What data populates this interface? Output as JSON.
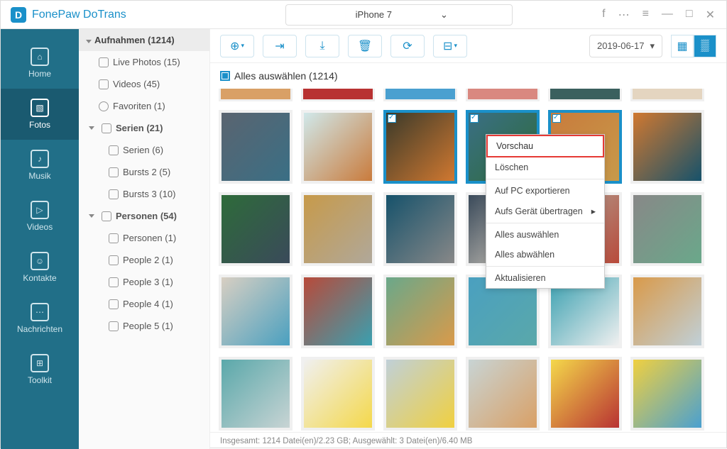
{
  "app_title": "FonePaw DoTrans",
  "device": "iPhone 7",
  "nav": {
    "home": "Home",
    "fotos": "Fotos",
    "musik": "Musik",
    "videos": "Videos",
    "kontakte": "Kontakte",
    "nachrichten": "Nachrichten",
    "toolkit": "Toolkit"
  },
  "tree": {
    "head": "Aufnahmen (1214)",
    "live": "Live Photos (15)",
    "videos": "Videos (45)",
    "fav": "Favoriten (1)",
    "serien_h": "Serien (21)",
    "serien": "Serien (6)",
    "b2": "Bursts 2 (5)",
    "b3": "Bursts 3 (10)",
    "pers_h": "Personen (54)",
    "pers": "Personen (1)",
    "p2": "People 2 (1)",
    "p3": "People 3 (1)",
    "p4": "People 4 (1)",
    "p5": "People 5 (1)"
  },
  "date": "2019-06-17",
  "selectall": "Alles auswählen (1214)",
  "ctx": {
    "vorschau": "Vorschau",
    "loeschen": "Löschen",
    "export_pc": "Auf PC exportieren",
    "aufs_geraet": "Aufs Gerät übertragen",
    "alles_aus": "Alles auswählen",
    "alles_ab": "Alles abwählen",
    "aktual": "Aktualisieren"
  },
  "status": "Insgesamt: 1214 Datei(en)/2.23 GB; Ausgewählt: 3 Datei(en)/6.40 MB",
  "thumb_colors": [
    "#d9a066",
    "#b83232",
    "#4aa0d0",
    "#d98880",
    "#3a605e",
    "#e4d5c0",
    "#5a6470",
    "#d0e8ea",
    "#3a3a2a",
    "#3a6f85",
    "#c97b3c",
    "#d07830",
    "#2e6b3a",
    "#c79a4a",
    "#16526b",
    "#3a4a5a",
    "#b0a89a",
    "#888888",
    "#d8cfc2",
    "#b84a3a",
    "#6aa88a",
    "#4aa0c0",
    "#3aa0b0",
    "#d99a4a",
    "#5aa8aa",
    "#f0f0f0",
    "#c0d0d8",
    "#c8d4d4",
    "#f4d84a",
    "#f0d040"
  ],
  "selected": [
    8,
    9,
    10
  ]
}
